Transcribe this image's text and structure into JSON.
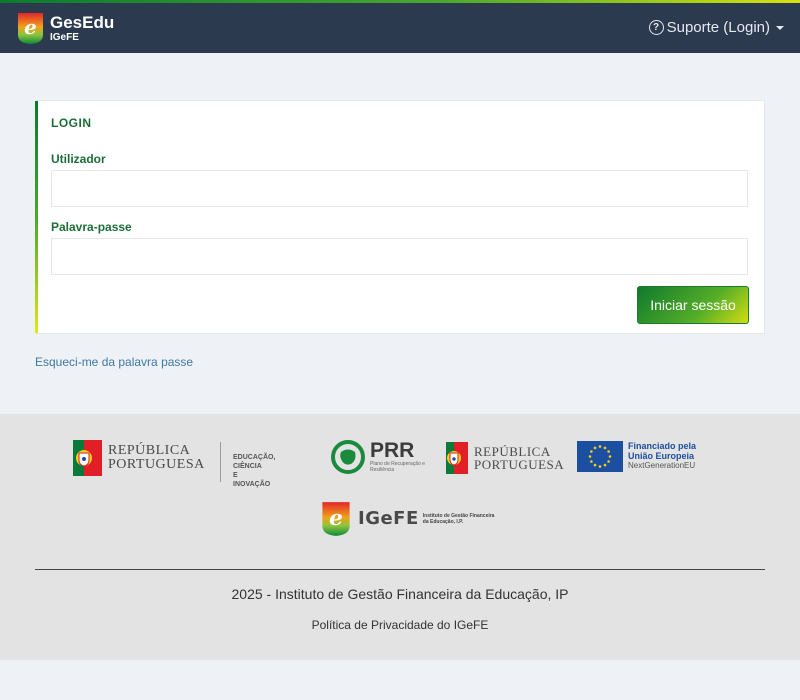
{
  "header": {
    "brand_name": "GesEdu",
    "brand_sub": "IGeFE",
    "support_label": "Suporte (Login)"
  },
  "login": {
    "title": "LOGIN",
    "username_label": "Utilizador",
    "username_value": "",
    "password_label": "Palavra-passe",
    "password_value": "",
    "submit_label": "Iniciar sessão",
    "forgot_label": "Esqueci-me da palavra passe"
  },
  "footer": {
    "rp_line1": "REPÚBLICA",
    "rp_line2": "PORTUGUESA",
    "rp_sub1": "EDUCAÇÃO, CIÊNCIA",
    "rp_sub2": "E INOVAÇÃO",
    "prr_big": "PRR",
    "prr_small": "Plano de Recuperação e Resiliência",
    "rp2_line1": "REPÚBLICA",
    "rp2_line2": "PORTUGUESA",
    "eu_line1": "Financiado pela",
    "eu_line2": "União Europeia",
    "eu_line3": "NextGenerationEU",
    "igefe_name": "IGeFE",
    "igefe_sub": "Instituto de Gestão Financeira da Educação, I.P.",
    "copyright": "2025 - Instituto de Gestão Financeira da Educação, IP",
    "privacy": "Política de Privacidade do IGeFE"
  },
  "colors": {
    "topbar": "#2b3a4f",
    "accent_green": "#1e6d38",
    "link_blue": "#3f79a5",
    "footer_bg": "#e3e3e3"
  }
}
